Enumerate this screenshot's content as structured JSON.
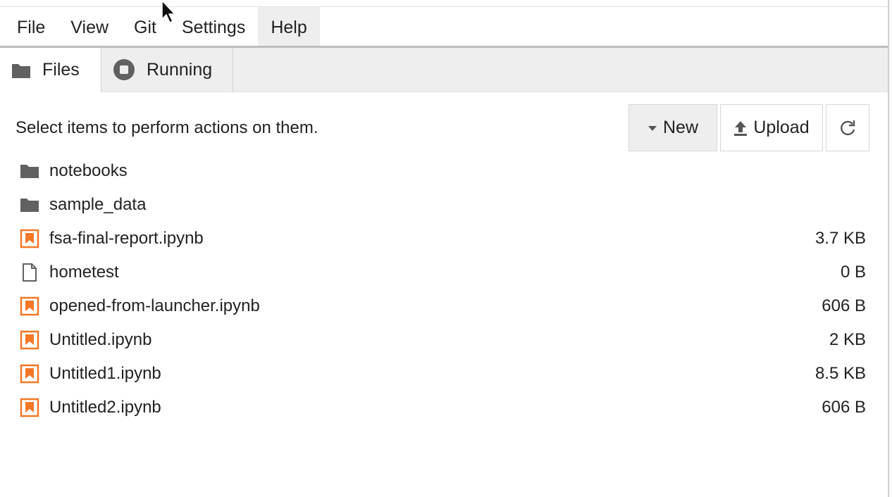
{
  "menubar": {
    "items": [
      "File",
      "View",
      "Git",
      "Settings",
      "Help"
    ],
    "active": "Help"
  },
  "tabs": [
    {
      "label": "Files",
      "icon": "folder-icon"
    },
    {
      "label": "Running",
      "icon": "stop-circle-icon"
    }
  ],
  "toolbar": {
    "hint": "Select items to perform actions on them.",
    "new_label": "New",
    "upload_label": "Upload",
    "refresh_icon": "refresh-icon"
  },
  "files": [
    {
      "name": "notebooks",
      "type": "folder",
      "size": ""
    },
    {
      "name": "sample_data",
      "type": "folder",
      "size": ""
    },
    {
      "name": "fsa-final-report.ipynb",
      "type": "notebook",
      "size": "3.7 KB"
    },
    {
      "name": "hometest",
      "type": "file",
      "size": "0 B"
    },
    {
      "name": "opened-from-launcher.ipynb",
      "type": "notebook",
      "size": "606 B"
    },
    {
      "name": "Untitled.ipynb",
      "type": "notebook",
      "size": "2 KB"
    },
    {
      "name": "Untitled1.ipynb",
      "type": "notebook",
      "size": "8.5 KB"
    },
    {
      "name": "Untitled2.ipynb",
      "type": "notebook",
      "size": "606 B"
    }
  ],
  "colors": {
    "notebook": "#f37726",
    "folder": "#616161",
    "accent_bg": "#eeeeee"
  }
}
